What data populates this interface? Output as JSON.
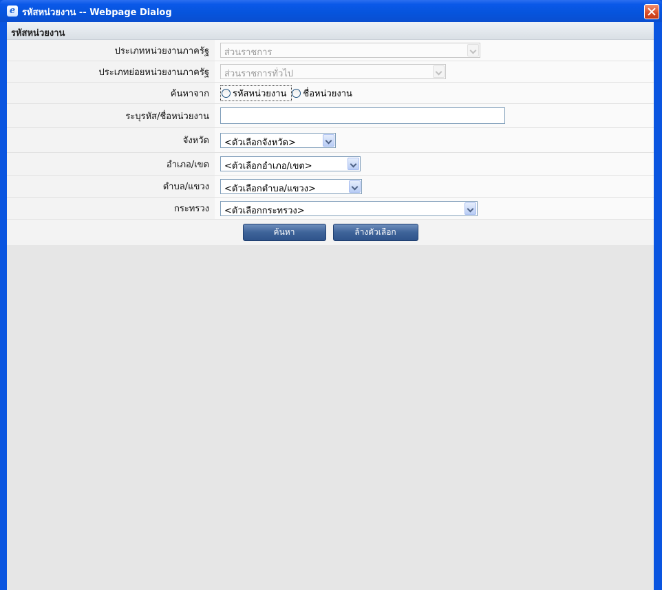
{
  "window": {
    "title": "รหัสหน่วยงาน -- Webpage Dialog"
  },
  "section": {
    "title": "รหัสหน่วยงาน"
  },
  "form": {
    "agency_type_label": "ประเภทหน่วยงานภาครัฐ",
    "agency_type_value": "ส่วนราชการ",
    "agency_subtype_label": "ประเภทย่อยหน่วยงานภาครัฐ",
    "agency_subtype_value": "ส่วนราชการทั่วไป",
    "search_from_label": "ค้นหาจาก",
    "search_by_code": "รหัสหน่วยงาน",
    "search_by_name": "ชื่อหน่วยงาน",
    "code_name_label": "ระบุรหัส/ชื่อหน่วยงาน",
    "code_name_value": "",
    "province_label": "จังหวัด",
    "province_value": "<ตัวเลือกจังหวัด>",
    "district_label": "อำเภอ/เขต",
    "district_value": "<ตัวเลือกอำเภอ/เขต>",
    "subdistrict_label": "ตำบล/แขวง",
    "subdistrict_value": "<ตัวเลือกตำบล/แขวง>",
    "ministry_label": "กระทรวง",
    "ministry_value": "<ตัวเลือกกระทรวง>"
  },
  "buttons": {
    "search": "ค้นหา",
    "clear": "ล้างตัวเลือก"
  }
}
